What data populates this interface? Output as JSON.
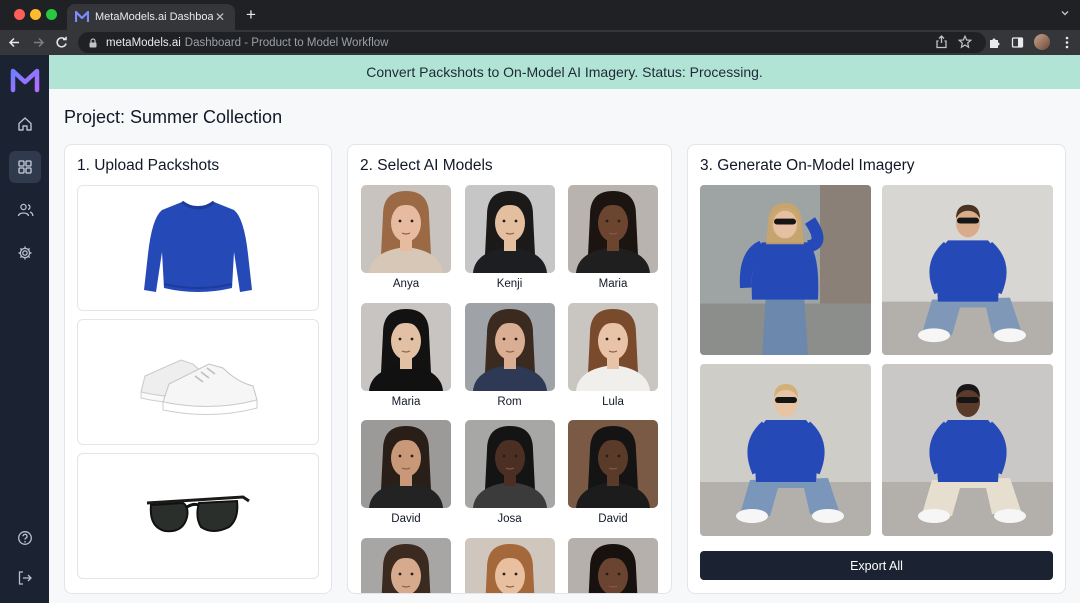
{
  "browser": {
    "tab_title": "MetaModels.ai Dashboard",
    "url_host": "metaModels.ai",
    "url_rest": "Dashboard - Product to Model Workflow"
  },
  "banner": {
    "text": "Convert Packshots to On-Model AI Imagery. Status: Processing."
  },
  "project": {
    "title": "Project: Summer Collection"
  },
  "sidebar": {
    "items": [
      {
        "icon": "home-icon"
      },
      {
        "icon": "grid-icon"
      },
      {
        "icon": "users-icon"
      },
      {
        "icon": "gear-icon"
      },
      {
        "icon": "help-icon"
      },
      {
        "icon": "logout-icon"
      }
    ]
  },
  "upload": {
    "title": "1. Upload Packshots",
    "items": [
      {
        "name": "blue-sweater",
        "color": "#2649b8"
      },
      {
        "name": "white-sneakers",
        "color": "#f4f4f4"
      },
      {
        "name": "black-sunglasses",
        "color": "#1a1a1a"
      }
    ]
  },
  "models": {
    "title": "2. Select AI Models",
    "list": [
      {
        "name": "Anya",
        "skin": "#e6bba0",
        "hair": "#9b6a45",
        "bg": "#c8c3bf",
        "top": "#d7c7b7"
      },
      {
        "name": "Kenji",
        "skin": "#e3bf9f",
        "hair": "#1c1a19",
        "bg": "#c6c6c6",
        "top": "#1d1e22"
      },
      {
        "name": "Maria",
        "skin": "#6c4530",
        "hair": "#1b1410",
        "bg": "#b8b3ae",
        "top": "#1f1f1f"
      },
      {
        "name": "Maria",
        "skin": "#e2c0a4",
        "hair": "#121212",
        "bg": "#c7c4c1",
        "top": "#111111"
      },
      {
        "name": "Rom",
        "skin": "#d9ae92",
        "hair": "#3a2a20",
        "bg": "#9fa3a8",
        "top": "#2e3a55"
      },
      {
        "name": "Lula",
        "skin": "#e8c3a8",
        "hair": "#7a4a2c",
        "bg": "#c9c5c1",
        "top": "#f0efec"
      },
      {
        "name": "David",
        "skin": "#c89878",
        "hair": "#2a1e18",
        "bg": "#9c9a98",
        "top": "#232323"
      },
      {
        "name": "Josa",
        "skin": "#4a2f22",
        "hair": "#141414",
        "bg": "#a7a7a6",
        "top": "#3b3b3b"
      },
      {
        "name": "David",
        "skin": "#5a3a28",
        "hair": "#141414",
        "bg": "#7a5a44",
        "top": "#1c1c1c"
      },
      {
        "name": "",
        "skin": "#d6aa8c",
        "hair": "#3b2a20",
        "bg": "#a8a6a4",
        "top": "#333333"
      },
      {
        "name": "",
        "skin": "#e8c0a0",
        "hair": "#a5683a",
        "bg": "#cfc6bd",
        "top": "#d6c8b8"
      },
      {
        "name": "",
        "skin": "#6b4431",
        "hair": "#171210",
        "bg": "#b5b0ab",
        "top": "#222222"
      }
    ]
  },
  "generate": {
    "title": "3. Generate On-Model Imagery",
    "images": [
      {
        "name": "woman-street",
        "bg": "#9ea3a3",
        "skin": "#e6c0a2",
        "hair": "#c9a46a",
        "pants": "#6c88ad"
      },
      {
        "name": "man-seated",
        "bg": "#d7d6d3",
        "skin": "#d8ab8a",
        "hair": "#4a3222",
        "pants": "#7f98b8"
      },
      {
        "name": "woman-seated",
        "bg": "#cfcdc8",
        "skin": "#e8c4a6",
        "hair": "#d2b07a",
        "pants": "#7a96ba"
      },
      {
        "name": "man-squat",
        "bg": "#c9c8c6",
        "skin": "#5a3a28",
        "hair": "#161616",
        "pants": "#e6dfcf"
      }
    ],
    "export_label": "Export All"
  },
  "colors": {
    "accent": "#1b2232",
    "banner": "#b2e4d6",
    "sweater": "#2649b8"
  }
}
